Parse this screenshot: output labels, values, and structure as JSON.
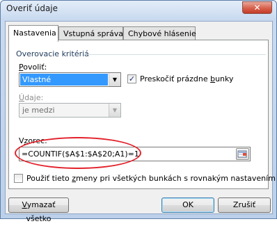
{
  "window": {
    "title": "Overiť údaje",
    "close_glyph": "✕"
  },
  "tabs": [
    {
      "label": "Nastavenia",
      "active": true
    },
    {
      "label": "Vstupná správa",
      "active": false
    },
    {
      "label": "Chybové hlásenie",
      "active": false
    }
  ],
  "criteria": {
    "group_label": "Overovacie kritériá",
    "allow_label": "Povoliť:",
    "allow_value": "Vlastné",
    "ignore_blank_label": "Preskočiť prázdne bunky",
    "ignore_blank_checked": true,
    "data_label": "Údaje:",
    "data_value": "je medzi",
    "formula_label": "Vzorec:",
    "formula_value": "=COUNTIF($A$1:$A$20;A1)=1"
  },
  "apply_all": {
    "label": "Použiť tieto zmeny pri všetkých bunkách s rovnakým nastavením",
    "checked": false
  },
  "buttons": {
    "clear_all": "Vymazať všetko",
    "ok": "OK",
    "cancel": "Zrušiť"
  },
  "glyphs": {
    "dropdown_arrow": "▼",
    "check": "✓"
  },
  "colors": {
    "selection": "#3399ff",
    "annotation_oval": "#e3202a",
    "close_button": "#c23c26"
  },
  "icons": {
    "range_selector": "range-selector-icon"
  }
}
